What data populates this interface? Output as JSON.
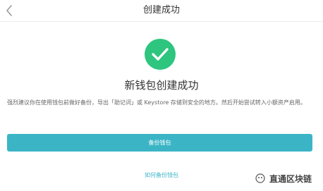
{
  "header": {
    "title": "创建成功",
    "back_icon": "chevron-left-icon"
  },
  "success": {
    "icon": "checkmark-circle-icon",
    "title": "新钱包创建成功"
  },
  "description": "强烈建议你在使用钱包前做好备份，导出「助记词」或 Keystore 存储到安全的地方。然后开始尝试转入小额资产启用。",
  "actions": {
    "backup_label": "备份钱包",
    "howto_label": "如何备份钱包"
  },
  "watermark": {
    "text": "直通区块链"
  },
  "colors": {
    "success_green": "#2ec57e",
    "button_teal": "#3bb5c6",
    "link_teal": "#3bb5c6",
    "nav_border": "#ededed"
  }
}
